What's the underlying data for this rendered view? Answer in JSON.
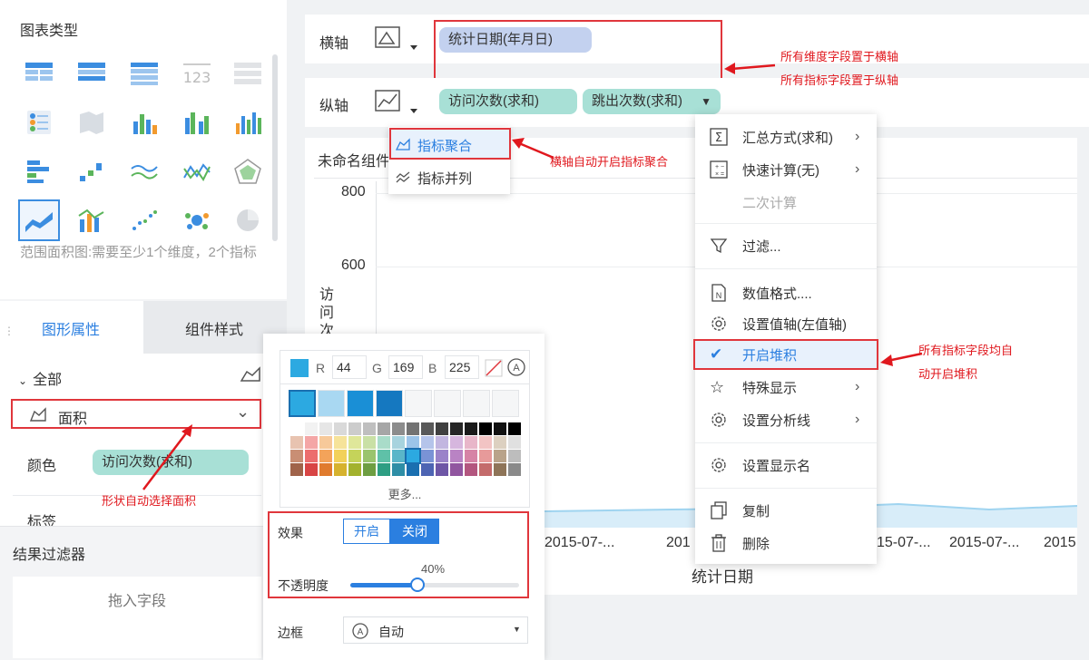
{
  "left_panel": {
    "chart_type_title": "图表类型",
    "chart_hint": "范围面积图:需要至少1个维度，2个指标",
    "tabs": [
      "图形属性",
      "组件样式"
    ],
    "all_label": "全部",
    "shape_label": "面积",
    "color_label": "颜色",
    "color_field": "访问次数(求和)",
    "tag_label": "标签",
    "filter_title": "结果过滤器",
    "drop_field": "拖入字段"
  },
  "axes": {
    "x_label": "横轴",
    "y_label": "纵轴",
    "x_fields": [
      "统计日期(年月日)"
    ],
    "y_fields": [
      "访问次数(求和)",
      "跳出次数(求和)"
    ]
  },
  "agg_menu": {
    "items": [
      "指标聚合",
      "指标并列"
    ]
  },
  "chart": {
    "component_title": "未命名组件",
    "y_ticks": [
      "800",
      "600"
    ],
    "y_axis_title": "访问次",
    "x_ticks": [
      "2015-07-...",
      "201",
      "15-07-...",
      "2015-07-...",
      "2015"
    ],
    "x_axis_title": "统计日期"
  },
  "context_menu": {
    "items": [
      "汇总方式(求和)",
      "快速计算(无)",
      "二次计算",
      "过滤...",
      "数值格式....",
      "设置值轴(左值轴)",
      "开启堆积",
      "特殊显示",
      "设置分析线",
      "设置显示名",
      "复制",
      "删除"
    ]
  },
  "color_picker": {
    "r_label": "R",
    "r": "44",
    "g_label": "G",
    "g": "169",
    "b_label": "B",
    "b": "225",
    "more": "更多...",
    "effect_label": "效果",
    "on": "开启",
    "off": "关闭",
    "opacity_label": "不透明度",
    "opacity_value": "40%",
    "opacity": 0.4,
    "border_label": "边框",
    "border_value": "自动",
    "accent": "#2ca9e1"
  },
  "annotations": {
    "dims_to_x": "所有维度字段置于横轴",
    "measures_to_y": "所有指标字段置于纵轴",
    "x_auto_agg": "横轴自动开启指标聚合",
    "auto_stack_1": "所有指标字段均自",
    "auto_stack_2": "动开启堆积",
    "shape_auto": "形状自动选择面积"
  }
}
